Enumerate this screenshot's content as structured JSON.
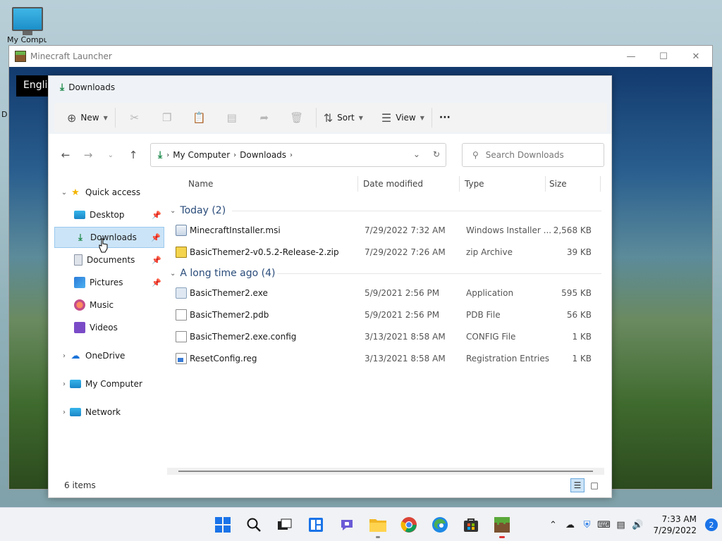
{
  "desktop": {
    "icon_label": "My Computer",
    "side_label": "D"
  },
  "launcher": {
    "title": "Minecraft Launcher",
    "language_selector": "English"
  },
  "explorer": {
    "title": "Downloads",
    "toolbar": {
      "new_label": "New",
      "sort_label": "Sort",
      "view_label": "View",
      "more_label": "···"
    },
    "address": {
      "crumbs": [
        "My Computer",
        "Downloads"
      ]
    },
    "search": {
      "placeholder": "Search Downloads"
    },
    "sidebar": {
      "quick_access": "Quick access",
      "items": [
        {
          "label": "Desktop"
        },
        {
          "label": "Downloads"
        },
        {
          "label": "Documents"
        },
        {
          "label": "Pictures"
        },
        {
          "label": "Music"
        },
        {
          "label": "Videos"
        }
      ],
      "onedrive": "OneDrive",
      "my_computer": "My Computer",
      "network": "Network"
    },
    "columns": {
      "name": "Name",
      "date": "Date modified",
      "type": "Type",
      "size": "Size"
    },
    "groups": [
      {
        "label": "Today (2)",
        "files": [
          {
            "name": "MinecraftInstaller.msi",
            "date": "7/29/2022 7:32 AM",
            "type": "Windows Installer ...",
            "size": "2,568 KB"
          },
          {
            "name": "BasicThemer2-v0.5.2-Release-2.zip",
            "date": "7/29/2022 7:26 AM",
            "type": "zip Archive",
            "size": "39 KB"
          }
        ]
      },
      {
        "label": "A long time ago (4)",
        "files": [
          {
            "name": "BasicThemer2.exe",
            "date": "5/9/2021 2:56 PM",
            "type": "Application",
            "size": "595 KB"
          },
          {
            "name": "BasicThemer2.pdb",
            "date": "5/9/2021 2:56 PM",
            "type": "PDB File",
            "size": "56 KB"
          },
          {
            "name": "BasicThemer2.exe.config",
            "date": "3/13/2021 8:58 AM",
            "type": "CONFIG File",
            "size": "1 KB"
          },
          {
            "name": "ResetConfig.reg",
            "date": "3/13/2021 8:58 AM",
            "type": "Registration Entries",
            "size": "1 KB"
          }
        ]
      }
    ],
    "status": "6 items"
  },
  "taskbar": {
    "time": "7:33 AM",
    "date": "7/29/2022",
    "notification_count": "2"
  },
  "colors": {
    "selection": "#cce4f7",
    "accent": "#1a73e8",
    "download_green": "#1f8a4c"
  }
}
